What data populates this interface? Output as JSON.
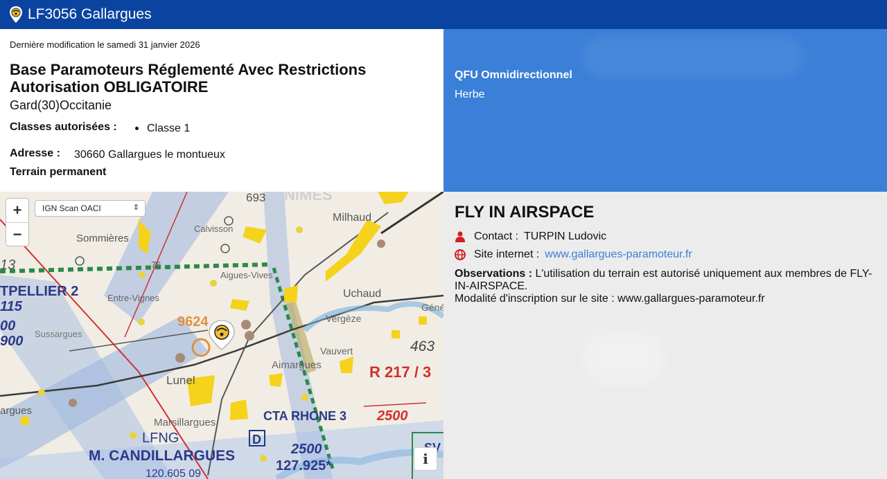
{
  "header": {
    "title": "LF3056 Gallargues",
    "pin_icon": "paramotor-pin-icon"
  },
  "info": {
    "last_modified": "Dernière modification le samedi 31 janvier 2026",
    "heading": "Base Paramoteurs Réglementé Avec Restrictions Autorisation OBLIGATOIRE",
    "region": "Gard(30)Occitanie",
    "classes_label": "Classes autorisées :",
    "classes": [
      "Classe 1"
    ],
    "address_label": "Adresse :",
    "address_value": "30660  Gallargues le montueux",
    "terrain": "Terrain permanent"
  },
  "runway": {
    "qfu": "QFU Omnidirectionnel",
    "surface": "Herbe"
  },
  "map": {
    "zoom_in": "+",
    "zoom_out": "−",
    "layer_selected": "IGN Scan OACI",
    "info_button": "i",
    "labels": {
      "nimes": "NIMES",
      "milhaud": "Milhaud",
      "calvisson": "Calvisson",
      "sommieres": "Sommières",
      "aigues_vives": "Aigues-Vives",
      "entre_vignes": "Entre-Vignes",
      "uchaud": "Uchaud",
      "vergeze": "Vergèze",
      "vauvert": "Vauvert",
      "aimargues": "Aimargues",
      "lunel": "Lunel",
      "marsillargues": "Marsillargues",
      "lfng": "LFNG",
      "candillargues": "M. CANDILLARGUES",
      "montpellier": "TPELLIER 2",
      "num_115": "115",
      "num_00": "00",
      "num_900": "900",
      "num_693": "693",
      "num_9624": "9624",
      "num_463": "463",
      "r217": "R 217 / 3",
      "r217_alt": "2500",
      "cta": "CTA RHONE 3",
      "cta_alt": "2500",
      "freq": "127.925*",
      "freq2": "120.605 09",
      "gen": "Géné",
      "sussargues": "Sussargues",
      "targues": "argues",
      "num_13": "13",
      "num_76": "76",
      "d_box": "D",
      "sv": "SV"
    }
  },
  "club": {
    "name": "FLY IN AIRSPACE",
    "contact_label": "Contact :",
    "contact_name": "TURPIN Ludovic",
    "site_label": "Site internet :",
    "site_url": "www.gallargues-paramoteur.fr",
    "observations_label": "Observations :",
    "observations_text": " L'utilisation du terrain est autorisé uniquement aux membres de FLY-IN-AIRSPACE.",
    "observations_line2": "Modalité d'inscription sur le site : www.gallargues-paramoteur.fr"
  },
  "colors": {
    "header": "#0a44a0",
    "runway_panel": "#3a7fd8",
    "link": "#3a7fd8",
    "icon_red": "#d02020"
  }
}
